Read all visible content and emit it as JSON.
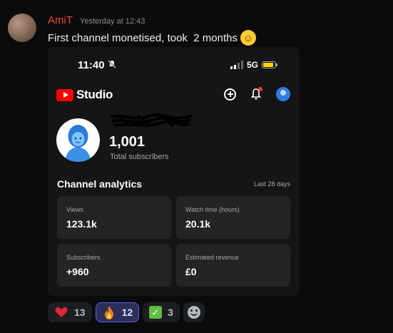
{
  "message": {
    "username": "AmiT",
    "timestamp": "Yesterday at 12:43",
    "text": "First channel monetised, took  2 months",
    "emoji": "grinning-face"
  },
  "phone": {
    "status_time": "11:40",
    "network": "5G",
    "app_title": "Studio",
    "subscribers_count": "1,001",
    "subscribers_label": "Total subscribers",
    "analytics_title": "Channel analytics",
    "analytics_range": "Last 28 days",
    "cards": [
      {
        "label": "Views",
        "value": "123.1k"
      },
      {
        "label": "Watch time (hours)",
        "value": "20.1k"
      },
      {
        "label": "Subscribers",
        "value": "+960"
      },
      {
        "label": "Estimated revenue",
        "value": "£0"
      }
    ],
    "battery_level": 0.85
  },
  "reactions": [
    {
      "emoji": "red-heart",
      "count": "13",
      "active": false
    },
    {
      "emoji": "fire",
      "count": "12",
      "active": true
    },
    {
      "emoji": "check-mark",
      "count": "3",
      "active": false
    }
  ],
  "colors": {
    "username": "#e74c3c",
    "youtube_red": "#ff0000",
    "active_reaction_border": "#5865f2"
  }
}
